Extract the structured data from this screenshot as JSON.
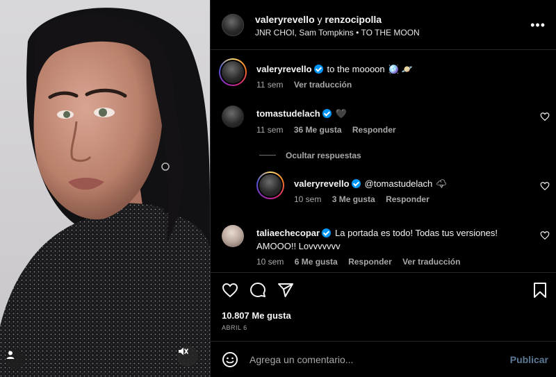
{
  "header": {
    "user1": "valeryrevello",
    "separator": "y",
    "user2": "renzocipolla",
    "audio": "JNR CHOI, Sam Tompkins • TO THE MOON"
  },
  "caption": {
    "username": "valeryrevello",
    "text": "to the moooon",
    "emojis": "🪩 🪐",
    "time": "11 sem",
    "translate": "Ver traducción"
  },
  "comments": [
    {
      "username": "tomastudelach",
      "text": "🖤",
      "time": "11 sem",
      "likes": "36 Me gusta",
      "reply": "Responder"
    },
    {
      "username": "valeryrevello",
      "text": "@tomastudelach",
      "emoji": "🌩",
      "time": "10 sem",
      "likes": "3 Me gusta",
      "reply": "Responder"
    },
    {
      "username": "taliaechecopar",
      "text_line1": "La portada es todo! Todas tus versiones!",
      "text_line2": "AMOOO!! Lovvvvvvv",
      "time": "10 sem",
      "likes": "6 Me gusta",
      "reply": "Responder",
      "translate": "Ver traducción"
    }
  ],
  "hide_replies": "Ocultar respuestas",
  "post": {
    "likes": "10.807 Me gusta",
    "date": "ABRIL 6"
  },
  "comment_bar": {
    "placeholder": "Agrega un comentario...",
    "publish": "Publicar"
  },
  "icons": {
    "like": "heart-icon",
    "comment": "comment-icon",
    "share": "send-icon",
    "save": "bookmark-icon",
    "more": "more-icon",
    "emoji": "emoji-icon",
    "tag": "user-tag-icon",
    "mute": "muted-speaker-icon"
  },
  "colors": {
    "background": "#000000",
    "muted_text": "#a8a8a8",
    "verified": "#0095f6",
    "publish_disabled": "#5b7895"
  }
}
